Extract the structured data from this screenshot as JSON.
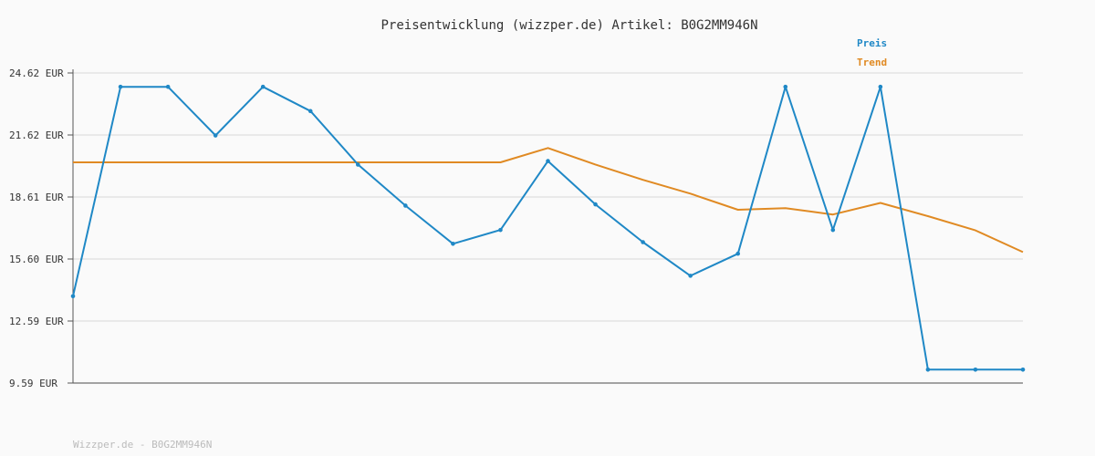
{
  "chart_data": {
    "type": "line",
    "title": "Preisentwicklung (wizzper.de) Artikel: B0G2MM946N",
    "y_unit": "EUR",
    "yticks": [
      "24.62 EUR",
      "21.62 EUR",
      "18.61 EUR",
      "15.60 EUR",
      "12.59 EUR",
      "9.59 EUR"
    ],
    "ylim": [
      9.59,
      24.62
    ],
    "grid": true,
    "legend_position": "top-right",
    "series": [
      {
        "name": "Preis",
        "color": "#1f88c6",
        "markers": true,
        "values": [
          13.8,
          23.95,
          23.95,
          21.59,
          23.95,
          22.77,
          20.18,
          18.19,
          16.34,
          17.01,
          20.35,
          18.25,
          16.42,
          14.79,
          15.86,
          23.95,
          17.01,
          23.95,
          10.24,
          10.24,
          10.24
        ]
      },
      {
        "name": "Trend",
        "color": "#e08a23",
        "markers": false,
        "values": [
          20.29,
          20.29,
          20.29,
          20.29,
          20.29,
          20.29,
          20.29,
          20.29,
          20.29,
          20.29,
          20.98,
          20.18,
          19.44,
          18.77,
          17.99,
          18.07,
          17.76,
          18.32,
          17.68,
          16.99,
          15.94
        ]
      }
    ]
  },
  "footer": {
    "text": "Wizzper.de - B0G2MM946N"
  }
}
